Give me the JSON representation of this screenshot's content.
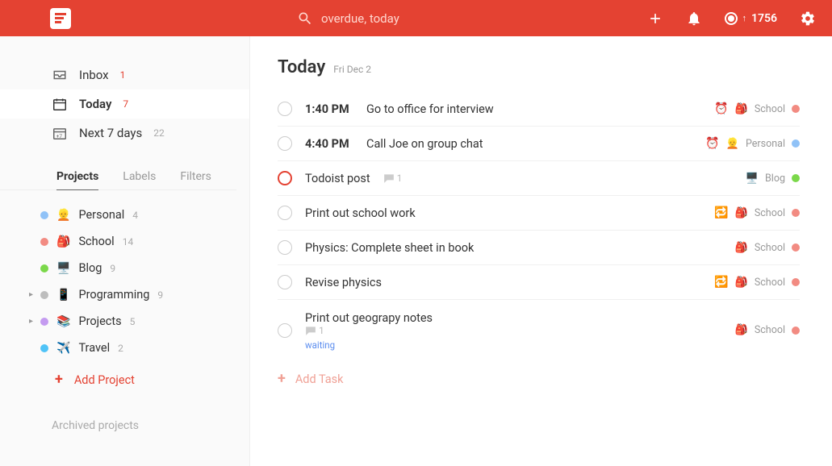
{
  "header": {
    "search_value": "overdue, today",
    "karma": "1756"
  },
  "sidebar": {
    "inbox": {
      "label": "Inbox",
      "count": "1"
    },
    "today": {
      "label": "Today",
      "count": "7"
    },
    "next7": {
      "label": "Next 7 days",
      "count": "22"
    },
    "tabs": {
      "projects": "Projects",
      "labels": "Labels",
      "filters": "Filters"
    },
    "projects": [
      {
        "dot": "#90c2f7",
        "emoji": "👱",
        "name": "Personal",
        "count": "4",
        "expandable": false
      },
      {
        "dot": "#f28b82",
        "emoji": "🎒",
        "name": "School",
        "count": "14",
        "expandable": false
      },
      {
        "dot": "#7bd84a",
        "emoji": "🖥️",
        "name": "Blog",
        "count": "9",
        "expandable": false
      },
      {
        "dot": "#bdbdbd",
        "emoji": "📱",
        "name": "Programming",
        "count": "9",
        "expandable": true
      },
      {
        "dot": "#c49bf0",
        "emoji": "📚",
        "name": "Projects",
        "count": "5",
        "expandable": true
      },
      {
        "dot": "#4fc3f7",
        "emoji": "✈️",
        "name": "Travel",
        "count": "2",
        "expandable": false
      }
    ],
    "add_project": "Add Project",
    "archived": "Archived projects"
  },
  "main": {
    "title": "Today",
    "date": "Fri Dec 2",
    "add_task": "Add Task",
    "tasks": [
      {
        "time": "1:40 PM",
        "title": "Go to office for interview",
        "priority": false,
        "reminder": true,
        "recurring": false,
        "comments": null,
        "tag": null,
        "project": {
          "emoji": "🎒",
          "name": "School",
          "dot": "#f28b82"
        }
      },
      {
        "time": "4:40 PM",
        "title": "Call Joe on group chat",
        "priority": false,
        "reminder": true,
        "recurring": false,
        "comments": null,
        "tag": null,
        "project": {
          "emoji": "👱",
          "name": "Personal",
          "dot": "#90c2f7"
        }
      },
      {
        "time": null,
        "title": "Todoist post",
        "priority": true,
        "reminder": false,
        "recurring": false,
        "comments": "1",
        "tag": null,
        "project": {
          "emoji": "🖥️",
          "name": "Blog",
          "dot": "#7bd84a"
        }
      },
      {
        "time": null,
        "title": "Print out school work",
        "priority": false,
        "reminder": false,
        "recurring": true,
        "comments": null,
        "tag": null,
        "project": {
          "emoji": "🎒",
          "name": "School",
          "dot": "#f28b82"
        }
      },
      {
        "time": null,
        "title": "Physics: Complete sheet in book",
        "priority": false,
        "reminder": false,
        "recurring": false,
        "comments": null,
        "tag": null,
        "project": {
          "emoji": "🎒",
          "name": "School",
          "dot": "#f28b82"
        }
      },
      {
        "time": null,
        "title": "Revise physics",
        "priority": false,
        "reminder": false,
        "recurring": true,
        "comments": null,
        "tag": null,
        "project": {
          "emoji": "🎒",
          "name": "School",
          "dot": "#f28b82"
        }
      },
      {
        "time": null,
        "title": "Print out geograpy notes",
        "priority": false,
        "reminder": false,
        "recurring": false,
        "comments": "1",
        "tag": "waiting",
        "project": {
          "emoji": "🎒",
          "name": "School",
          "dot": "#f28b82"
        }
      }
    ]
  },
  "colors": {
    "accent": "#e44232"
  }
}
